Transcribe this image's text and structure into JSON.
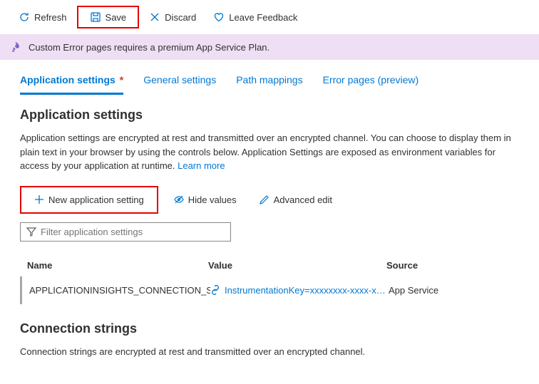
{
  "toolbar": {
    "refresh": "Refresh",
    "save": "Save",
    "discard": "Discard",
    "feedback": "Leave Feedback"
  },
  "banner": {
    "text": "Custom Error pages requires a premium App Service Plan."
  },
  "tabs": {
    "app_settings": "Application settings",
    "general": "General settings",
    "path": "Path mappings",
    "error": "Error pages (preview)"
  },
  "app_settings": {
    "title": "Application settings",
    "description": "Application settings are encrypted at rest and transmitted over an encrypted channel. You can choose to display them in plain text in your browser by using the controls below. Application Settings are exposed as environment variables for access by your application at runtime. ",
    "learn_more": "Learn more",
    "new_setting": "New application setting",
    "hide_values": "Hide values",
    "advanced_edit": "Advanced edit",
    "filter_placeholder": "Filter application settings"
  },
  "table": {
    "headers": {
      "name": "Name",
      "value": "Value",
      "source": "Source"
    },
    "rows": [
      {
        "name": "APPLICATIONINSIGHTS_CONNECTION_STRING",
        "value": "InstrumentationKey=xxxxxxxx-xxxx-xxxx",
        "source": "App Service"
      }
    ]
  },
  "conn_strings": {
    "title": "Connection strings",
    "description": "Connection strings are encrypted at rest and transmitted over an encrypted channel."
  }
}
